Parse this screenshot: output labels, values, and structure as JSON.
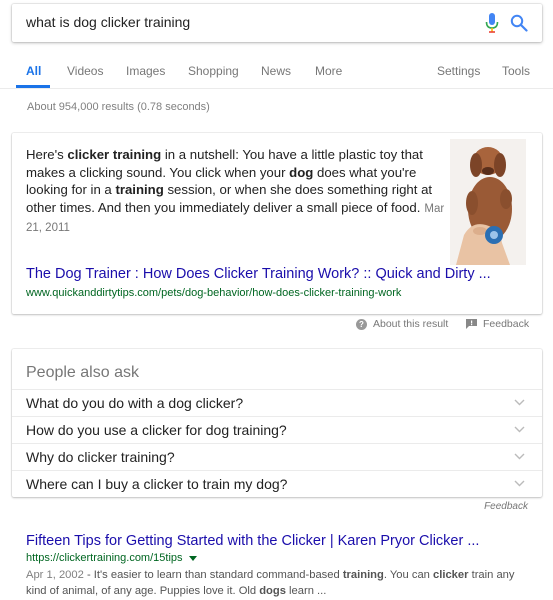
{
  "search": {
    "query": "what is dog clicker training"
  },
  "tabs": {
    "items": [
      "All",
      "Videos",
      "Images",
      "Shopping",
      "News",
      "More"
    ],
    "right": [
      "Settings",
      "Tools"
    ],
    "active": "All"
  },
  "stats": "About 954,000 results (0.78 seconds)",
  "snippet": {
    "text_parts": [
      "Here's ",
      "clicker training",
      " in a nutshell: You have a little plastic toy that makes a clicking sound. You click when your ",
      "dog",
      " does what you're looking for in a ",
      "training",
      " session, or when she does something right at other times. And then you immediately deliver a small piece of food."
    ],
    "date": "Mar 21, 2011",
    "title": "The Dog Trainer : How Does Clicker Training Work? :: Quick and Dirty ...",
    "url": "www.quickanddirtytips.com/pets/dog-behavior/how-does-clicker-training-work",
    "image_icon": "dog-with-clicker-photo"
  },
  "about": {
    "about_label": "About this result",
    "feedback_label": "Feedback"
  },
  "paa": {
    "title": "People also ask",
    "questions": [
      "What do you do with a dog clicker?",
      "How do you use a clicker for dog training?",
      "Why do clicker training?",
      "Where can I buy a clicker to train my dog?"
    ],
    "feedback": "Feedback"
  },
  "result": {
    "title": "Fifteen Tips for Getting Started with the Clicker | Karen Pryor Clicker ...",
    "url": "https://clickertraining.com/15tips",
    "date": "Apr 1, 2002",
    "desc_parts": [
      " - It's easier to learn than standard command-based ",
      "training",
      ". You can ",
      "clicker",
      " train any kind of animal, of any age. Puppies love it. Old ",
      "dogs",
      " learn ..."
    ]
  },
  "colors": {
    "accent": "#1a73e8",
    "link": "#1a0dab",
    "url_green": "#006621"
  }
}
